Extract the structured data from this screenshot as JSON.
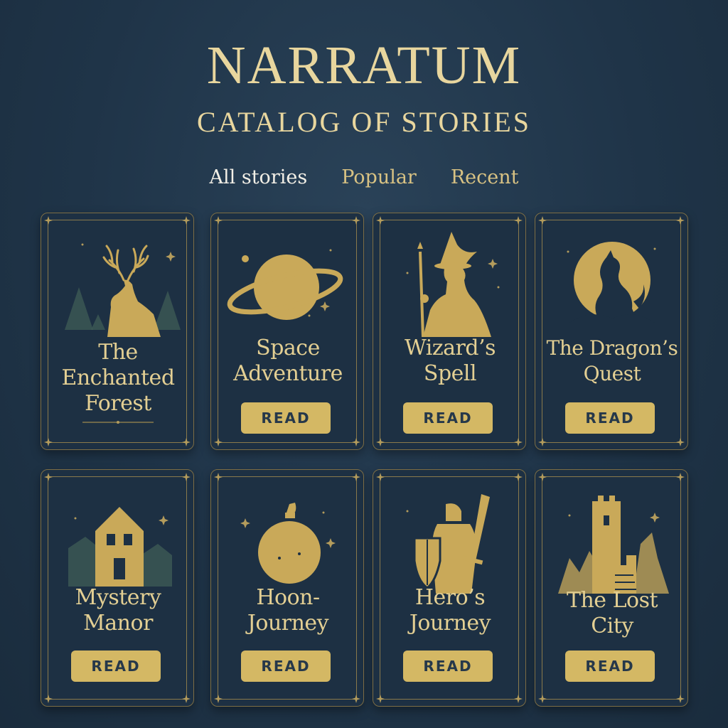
{
  "header": {
    "title": "NARRATUM",
    "subtitle": "CATALOG OF STORIES"
  },
  "tabs": [
    {
      "label": "All stories",
      "active": true
    },
    {
      "label": "Popular",
      "active": false
    },
    {
      "label": "Recent",
      "active": false
    }
  ],
  "stories": [
    {
      "title": "The\nEnchanted\nForest",
      "icon": "deer-icon",
      "button": ""
    },
    {
      "title": "Space\nAdventure",
      "icon": "planet-icon",
      "button": "READ"
    },
    {
      "title": "Wizard’s\nSpell",
      "icon": "wizard-icon",
      "button": "READ"
    },
    {
      "title": "The Dragon’s\nQuest",
      "icon": "dragon-moon-icon",
      "button": "READ"
    },
    {
      "title": "Mystery\nManor",
      "icon": "manor-icon",
      "button": "READ"
    },
    {
      "title": "Hoon-\nJourney",
      "icon": "moon-potion-icon",
      "button": "READ"
    },
    {
      "title": "Hero’s\nJourney",
      "icon": "knight-icon",
      "button": "READ"
    },
    {
      "title": "The Lost\nCity",
      "icon": "ruined-tower-icon",
      "button": "READ"
    }
  ],
  "colors": {
    "background": "#1f3448",
    "gold": "#d4b864",
    "card": "#1d3043"
  }
}
